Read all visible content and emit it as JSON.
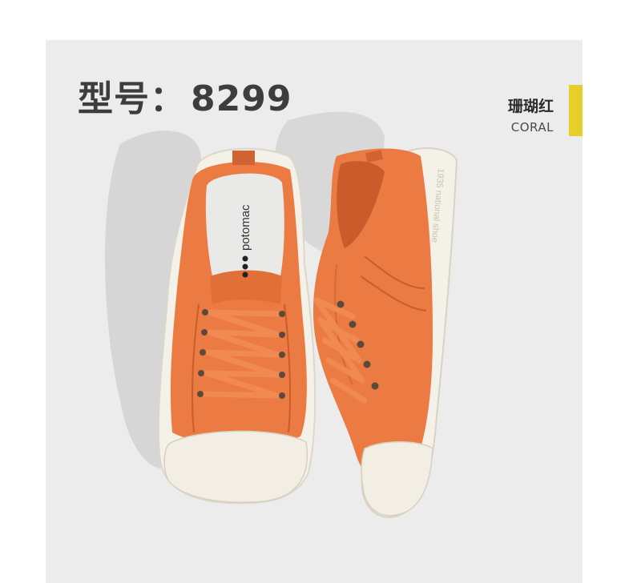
{
  "product": {
    "model_label": "型号：",
    "model_number": "8299",
    "color_name_cn": "珊瑚红",
    "color_name_en": "CORAL",
    "insole_brand": "potomac",
    "sole_text": "1935 national shoe"
  },
  "colors": {
    "background": "#ececec",
    "accent_bar": "#e6cf2a",
    "upper": "#ec7b43",
    "upper_shadow": "#c95c2a",
    "sole": "#f4f1e8",
    "insole": "#e9e9e7",
    "eyelet": "#5b4a3a"
  }
}
